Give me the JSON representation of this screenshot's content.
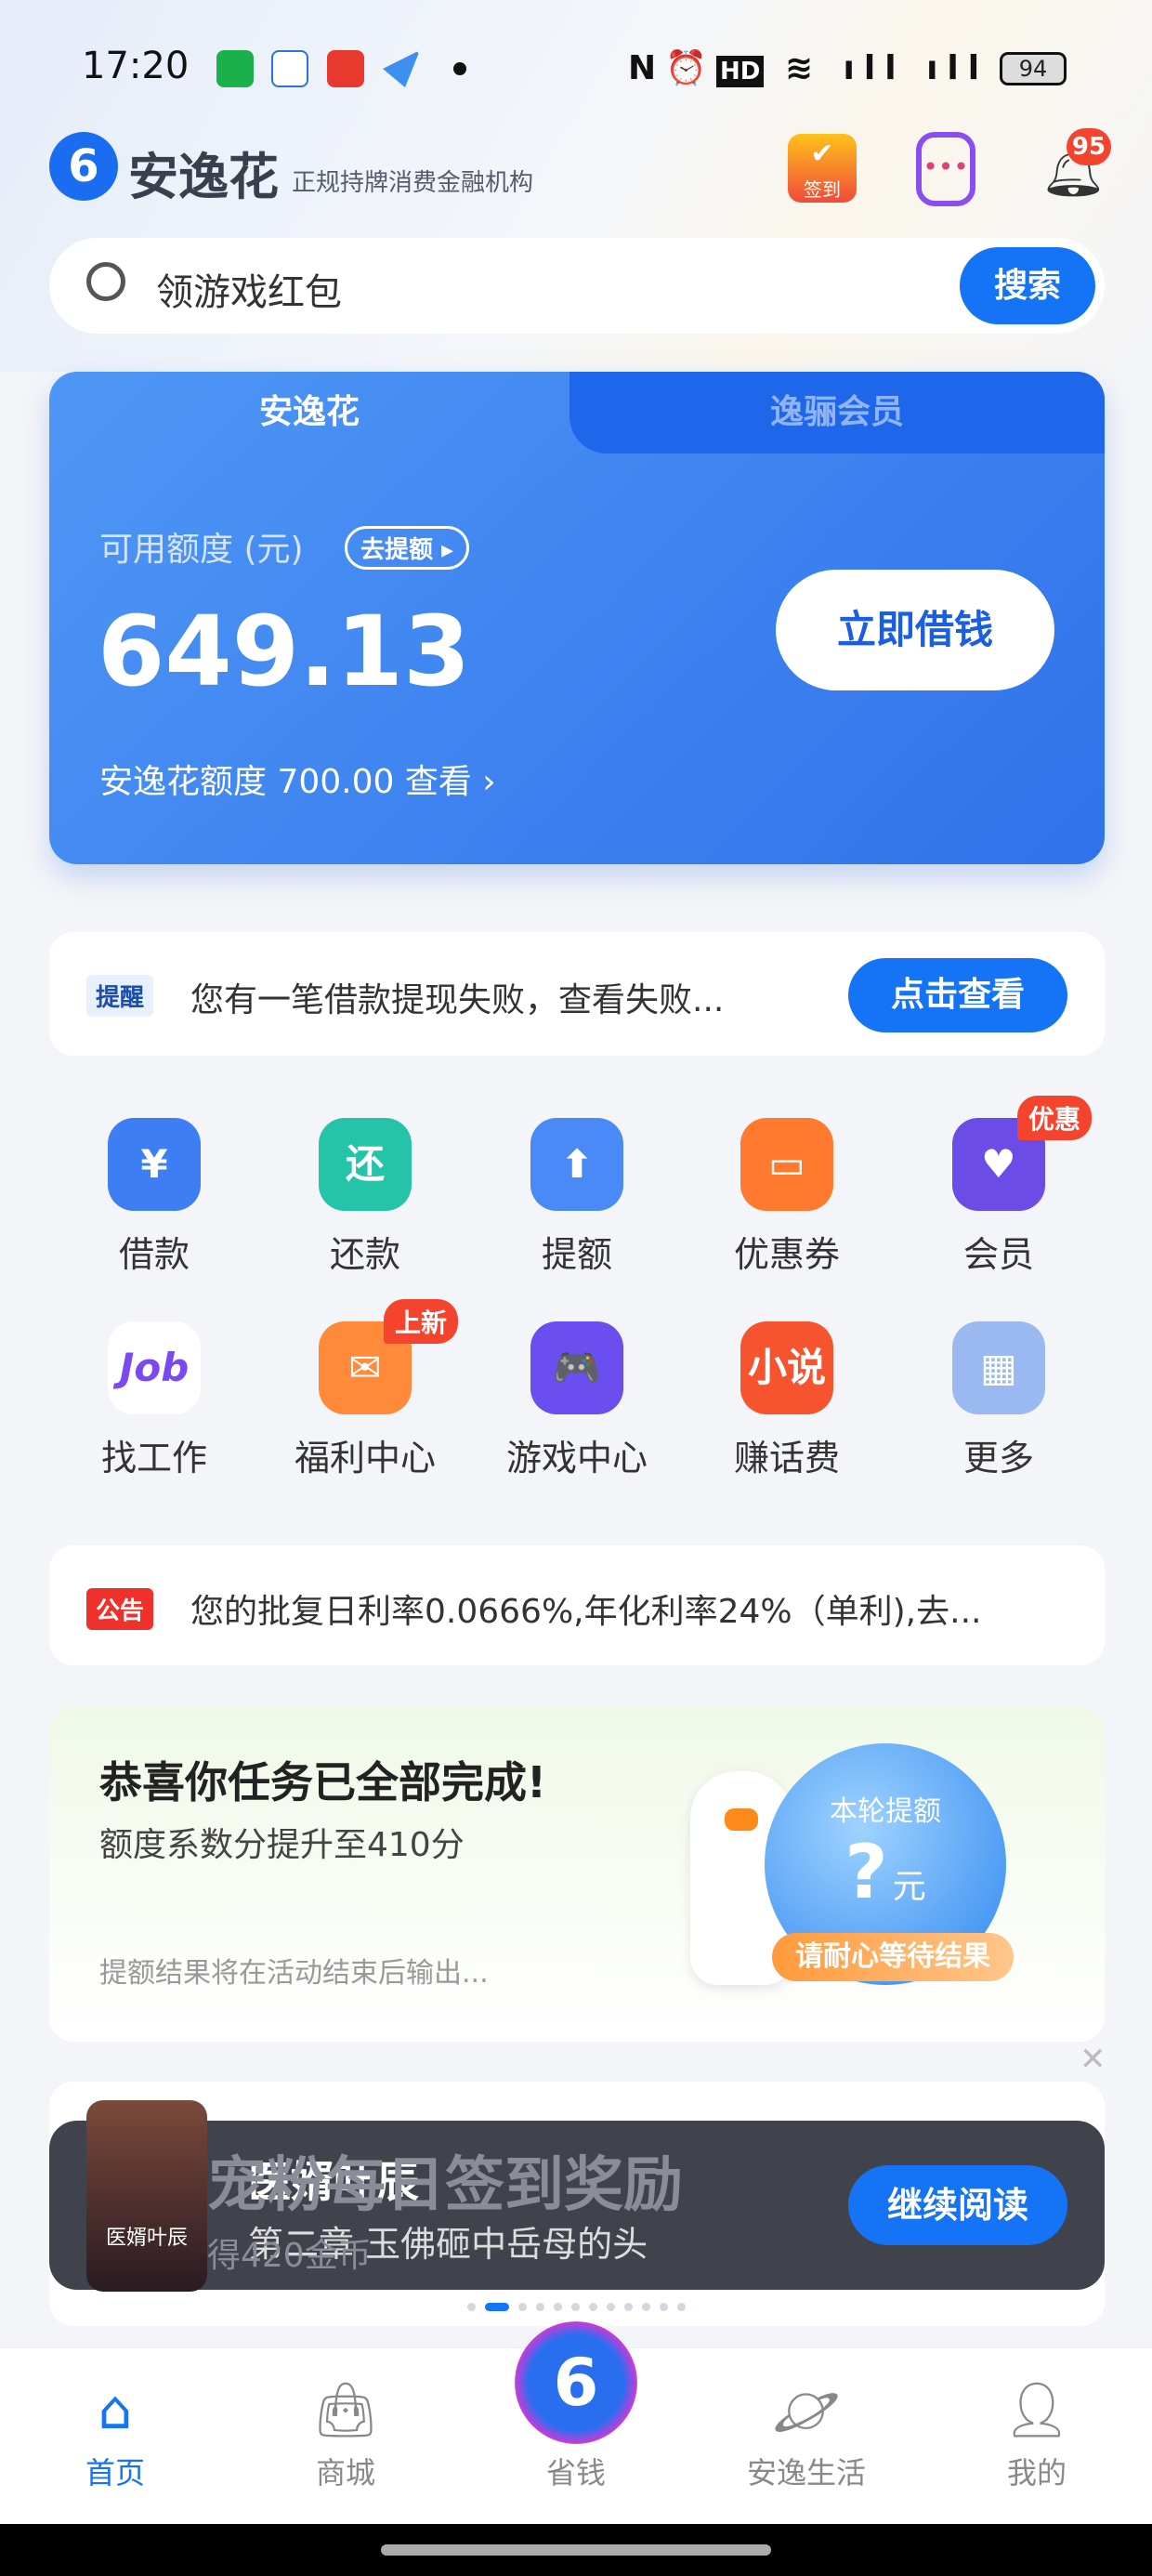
{
  "status_bar": {
    "time": "17:20",
    "battery": "94",
    "indicators": [
      "nfc-icon",
      "alarm-icon",
      "hd-icon",
      "wifi-icon",
      "5g-signal-icon",
      "5g-signal-icon"
    ]
  },
  "header": {
    "brand": "安逸花",
    "slogan": "正规持牌消费金融机构",
    "checkin_label": "签到",
    "notification_count": "95"
  },
  "search": {
    "placeholder": "领游戏红包",
    "button": "搜索"
  },
  "credit_card": {
    "tabs": [
      "安逸花",
      "逸骊会员"
    ],
    "available_label": "可用额度 (元)",
    "raise_label": "去提额 ▸",
    "amount": "649.13",
    "limit_text": "安逸花额度 700.00 查看 ›",
    "borrow_button": "立即借钱"
  },
  "reminder": {
    "tag": "提醒",
    "text": "您有一笔借款提现失败，查看失败...",
    "button": "点击查看"
  },
  "grid": [
    {
      "label": "借款",
      "icon": "borrow-icon",
      "color": "#3d7ef5",
      "glyph": "¥"
    },
    {
      "label": "还款",
      "icon": "repay-icon",
      "color": "#25c4a8",
      "glyph": "还"
    },
    {
      "label": "提额",
      "icon": "raise-limit-icon",
      "color": "#4a8af7",
      "glyph": "⬆"
    },
    {
      "label": "优惠券",
      "icon": "coupon-icon",
      "color": "#ff7a2e",
      "glyph": "▭"
    },
    {
      "label": "会员",
      "icon": "member-icon",
      "color": "#6c4ce6",
      "glyph": "♥",
      "badge": "优惠"
    },
    {
      "label": "找工作",
      "icon": "job-icon",
      "color": "#ffffff",
      "glyph": "Job"
    },
    {
      "label": "福利中心",
      "icon": "gift-icon",
      "color": "#ff8a3a",
      "glyph": "✉",
      "badge": "上新"
    },
    {
      "label": "游戏中心",
      "icon": "gamepad-icon",
      "color": "#6a4ef0",
      "glyph": "🎮"
    },
    {
      "label": "赚话费",
      "icon": "novel-icon",
      "color": "#f5542e",
      "glyph": "小说"
    },
    {
      "label": "更多",
      "icon": "more-grid-icon",
      "color": "#9ab9f0",
      "glyph": "▦"
    }
  ],
  "notice": {
    "tag": "公告",
    "text": "您的批复日利率0.0666%,年化利率24%（单利),去..."
  },
  "task": {
    "title": "恭喜你任务已全部完成!",
    "subtitle": "额度系数分提升至410分",
    "footer": "提额结果将在活动结束后输出...",
    "bubble_label": "本轮提额",
    "bubble_value": "?",
    "bubble_unit": "元",
    "wait_label": "请耐心等待结果"
  },
  "ad": {
    "bg_title": "宠粉每日签到奖励",
    "bg_sub": "得420金币",
    "book_title": "医婿叶辰",
    "chapter": "第二章 玉佛砸中岳母的头",
    "button": "继续阅读",
    "cover_text": "医婿叶辰",
    "carousel_total": 12,
    "carousel_active": 1
  },
  "bottom_nav": [
    {
      "label": "首页",
      "icon": "home-icon",
      "active": true
    },
    {
      "label": "商城",
      "icon": "shopping-bag-icon"
    },
    {
      "label": "省钱",
      "icon": "save-money-logo-icon"
    },
    {
      "label": "安逸生活",
      "icon": "planet-icon"
    },
    {
      "label": "我的",
      "icon": "profile-icon"
    }
  ],
  "colors": {
    "primary": "#1474f5",
    "badge": "#f5442e",
    "ad_overlay": "#3e414b"
  }
}
